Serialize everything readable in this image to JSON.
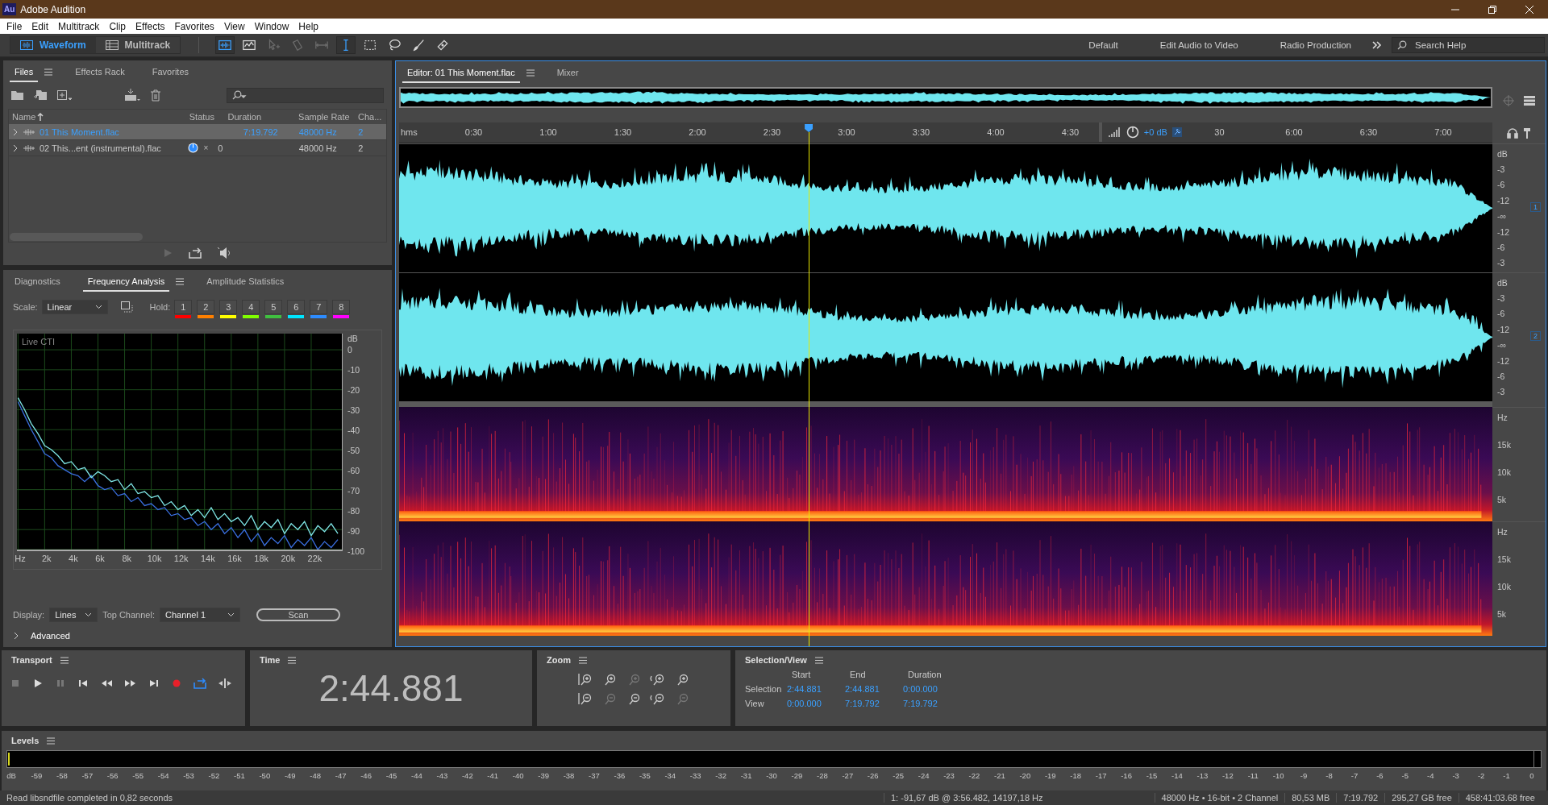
{
  "window": {
    "title": "Adobe Audition",
    "app_badge": "Au"
  },
  "menu": [
    "File",
    "Edit",
    "Multitrack",
    "Clip",
    "Effects",
    "Favorites",
    "View",
    "Window",
    "Help"
  ],
  "toolbar": {
    "modes": [
      {
        "label": "Waveform",
        "kind": "waveform",
        "selected": true
      },
      {
        "label": "Multitrack",
        "kind": "multitrack",
        "selected": false
      }
    ],
    "tools": [
      {
        "kind": "spectral",
        "selected": true,
        "disabled": false
      },
      {
        "kind": "pitch",
        "selected": false,
        "disabled": false
      },
      {
        "kind": "move",
        "selected": false,
        "disabled": true
      },
      {
        "kind": "razor",
        "selected": false,
        "disabled": true
      },
      {
        "kind": "slip",
        "selected": false,
        "disabled": true
      },
      {
        "kind": "ibeam",
        "selected": true,
        "disabled": false
      },
      {
        "kind": "marquee",
        "selected": false,
        "disabled": false
      },
      {
        "kind": "lasso",
        "selected": false,
        "disabled": false
      },
      {
        "kind": "brush",
        "selected": false,
        "disabled": false
      },
      {
        "kind": "heal",
        "selected": false,
        "disabled": false
      }
    ],
    "workspaces": [
      "Default",
      "Edit Audio to Video",
      "Radio Production"
    ],
    "search": {
      "placeholder": "Search Help"
    }
  },
  "files_panel": {
    "tabs": [
      {
        "label": "Files",
        "selected": true
      },
      {
        "label": "Effects Rack",
        "selected": false
      },
      {
        "label": "Favorites",
        "selected": false
      }
    ],
    "columns": [
      "Name",
      "Status",
      "Duration",
      "Sample Rate",
      "Cha..."
    ],
    "rows": [
      {
        "name": "01 This Moment.flac",
        "loading": false,
        "status": [],
        "duration": "7:19.792",
        "sample_rate": "48000 Hz",
        "channels": "2",
        "selected": true
      },
      {
        "name": "02 This...ent (instrumental).flac",
        "loading": true,
        "status": [
          "×",
          "0"
        ],
        "duration": "",
        "sample_rate": "48000 Hz",
        "channels": "2",
        "selected": false
      }
    ]
  },
  "analysis_panel": {
    "tabs": [
      {
        "label": "Diagnostics",
        "selected": false
      },
      {
        "label": "Frequency Analysis",
        "selected": true
      },
      {
        "label": "Amplitude Statistics",
        "selected": false
      }
    ],
    "scale": {
      "label": "Scale:",
      "value": "Linear"
    },
    "hold": {
      "label": "Hold:",
      "buttons": [
        {
          "label": "1",
          "color": "#ff0000"
        },
        {
          "label": "2",
          "color": "#ff8000"
        },
        {
          "label": "3",
          "color": "#ffff00"
        },
        {
          "label": "4",
          "color": "#80ff00"
        },
        {
          "label": "5",
          "color": "#40c040"
        },
        {
          "label": "6",
          "color": "#00e5ff"
        },
        {
          "label": "7",
          "color": "#2d8cff"
        },
        {
          "label": "8",
          "color": "#ff00ff"
        }
      ]
    },
    "plot": {
      "caption": "Live CTI",
      "chart_data": {
        "type": "line",
        "grid": true,
        "ylabel": "dB",
        "xlim": [
          0,
          24300
        ],
        "ylim": [
          -100,
          8.1
        ],
        "xticks": [
          {
            "value": 0,
            "label": "Hz"
          },
          {
            "value": 2000,
            "label": "2k"
          },
          {
            "value": 4000,
            "label": "4k"
          },
          {
            "value": 6000,
            "label": "6k"
          },
          {
            "value": 8000,
            "label": "8k"
          },
          {
            "value": 10000,
            "label": "10k"
          },
          {
            "value": 12000,
            "label": "12k"
          },
          {
            "value": 14000,
            "label": "14k"
          },
          {
            "value": 16000,
            "label": "16k"
          },
          {
            "value": 18000,
            "label": "18k"
          },
          {
            "value": 20000,
            "label": "20k"
          },
          {
            "value": 22000,
            "label": "22k"
          }
        ],
        "yticks": [
          {
            "value": 0,
            "label": "0"
          },
          {
            "value": -10,
            "label": "-10"
          },
          {
            "value": -20,
            "label": "-20"
          },
          {
            "value": -30,
            "label": "-30"
          },
          {
            "value": -40,
            "label": "-40"
          },
          {
            "value": -50,
            "label": "-50"
          },
          {
            "value": -60,
            "label": "-60"
          },
          {
            "value": -70,
            "label": "-70"
          },
          {
            "value": -80,
            "label": "-80"
          },
          {
            "value": -90,
            "label": "-90"
          },
          {
            "value": -100,
            "label": "-100"
          }
        ],
        "x": [
          0,
          500,
          1000,
          1500,
          2000,
          2500,
          3000,
          3500,
          4000,
          4500,
          5000,
          5500,
          6000,
          6500,
          7000,
          7500,
          8000,
          8500,
          9000,
          9500,
          10000,
          10500,
          11000,
          11500,
          12000,
          12500,
          13000,
          13500,
          14000,
          14500,
          15000,
          15500,
          16000,
          16500,
          17000,
          17500,
          18000,
          18500,
          19000,
          19500,
          20000,
          20500,
          21000,
          21500,
          22000,
          22500,
          23000,
          23500,
          24000
        ],
        "series": [
          {
            "color": "#3a6fe0",
            "values": [
              -26,
              -33,
              -40,
              -46,
              -52,
              -54,
              -58,
              -60,
              -62,
              -63,
              -66,
              -63,
              -68,
              -70,
              -69,
              -73,
              -72,
              -76,
              -74,
              -78,
              -77,
              -80,
              -79,
              -83,
              -82,
              -85,
              -84,
              -88,
              -86,
              -90,
              -87,
              -92,
              -89,
              -94,
              -90,
              -96,
              -92,
              -98,
              -94,
              -97,
              -93,
              -99,
              -95,
              -98,
              -94,
              -100,
              -96,
              -99,
              -95
            ]
          },
          {
            "color": "#7fe6e6",
            "values": [
              -24,
              -30,
              -37,
              -42,
              -48,
              -50,
              -53,
              -57,
              -56,
              -60,
              -59,
              -64,
              -61,
              -63,
              -66,
              -65,
              -70,
              -67,
              -72,
              -71,
              -74,
              -73,
              -78,
              -76,
              -80,
              -78,
              -83,
              -80,
              -84,
              -79,
              -85,
              -82,
              -86,
              -84,
              -88,
              -83,
              -90,
              -86,
              -89,
              -85,
              -92,
              -87,
              -90,
              -86,
              -93,
              -88,
              -91,
              -87,
              -92
            ]
          }
        ]
      }
    },
    "display": {
      "label": "Display:",
      "value": "Lines"
    },
    "top_channel": {
      "label": "Top Channel:",
      "value": "Channel 1"
    },
    "scan_button": "Scan",
    "advanced": {
      "label": "Advanced",
      "expanded": false
    }
  },
  "editor": {
    "tabs": [
      {
        "label": "Editor: 01 This Moment.flac",
        "selected": true
      },
      {
        "label": "Mixer",
        "selected": false
      }
    ],
    "ruler": {
      "unit": "hms",
      "labels": [
        "0:30",
        "1:00",
        "1:30",
        "2:00",
        "2:30",
        "3:00",
        "3:30",
        "4:00",
        "4:30",
        "30",
        "6:00",
        "6:30",
        "7:00"
      ]
    },
    "hud": {
      "gain": "+0 dB"
    },
    "cti": {
      "level": 0.3747
    },
    "channels": [
      {
        "badge": "1",
        "scale": [
          "dB",
          "-3",
          "-6",
          "-12",
          "-∞",
          "-12",
          "-6",
          "-3"
        ]
      },
      {
        "badge": "2",
        "scale": [
          "dB",
          "-3",
          "-6",
          "-12",
          "-∞",
          "-12",
          "-6",
          "-3"
        ]
      }
    ],
    "spectral": [
      {
        "scale": [
          "Hz",
          "15k",
          "10k",
          "5k"
        ]
      },
      {
        "scale": [
          "Hz",
          "15k",
          "10k",
          "5k"
        ]
      }
    ]
  },
  "transport": {
    "title": "Transport"
  },
  "time": {
    "title": "Time",
    "value": "2:44.881"
  },
  "zoom": {
    "title": "Zoom"
  },
  "selection_view": {
    "title": "Selection/View",
    "columns": [
      "Start",
      "End",
      "Duration"
    ],
    "rows": [
      {
        "label": "Selection",
        "values": [
          "2:44.881",
          "2:44.881",
          "0:00.000"
        ]
      },
      {
        "label": "View",
        "values": [
          "0:00.000",
          "7:19.792",
          "7:19.792"
        ]
      }
    ]
  },
  "levels": {
    "title": "Levels",
    "scale": [
      "dB",
      "-59",
      "-58",
      "-57",
      "-56",
      "-55",
      "-54",
      "-53",
      "-52",
      "-51",
      "-50",
      "-49",
      "-48",
      "-47",
      "-46",
      "-45",
      "-44",
      "-43",
      "-42",
      "-41",
      "-40",
      "-39",
      "-38",
      "-37",
      "-36",
      "-35",
      "-34",
      "-33",
      "-32",
      "-31",
      "-30",
      "-29",
      "-28",
      "-27",
      "-26",
      "-25",
      "-24",
      "-23",
      "-22",
      "-21",
      "-20",
      "-19",
      "-18",
      "-17",
      "-16",
      "-15",
      "-14",
      "-13",
      "-12",
      "-11",
      "-10",
      "-9",
      "-8",
      "-7",
      "-6",
      "-5",
      "-4",
      "-3",
      "-2",
      "-1",
      "0"
    ]
  },
  "status_bar": {
    "message": "Read libsndfile completed in 0,82 seconds",
    "cursor": "1: -91,67 dB @ 3:56.482, 14197,18 Hz",
    "format": "48000 Hz • 16-bit • 2 Channel",
    "size": "80,53 MB",
    "duration": "7:19.792",
    "disk_free": "295,27 GB free",
    "time_free": "458:41:03.68 free"
  }
}
